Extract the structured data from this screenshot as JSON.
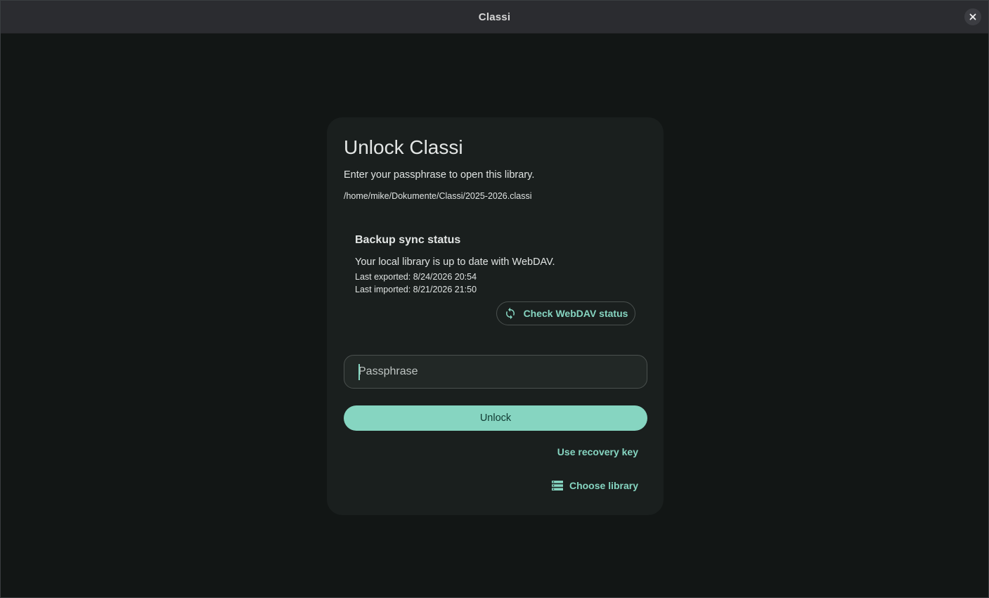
{
  "window": {
    "title": "Classi",
    "close_icon": "close-icon"
  },
  "card": {
    "title": "Unlock Classi",
    "subtitle": "Enter your passphrase to open this library.",
    "path": "/home/mike/Dokumente/Classi/2025-2026.classi"
  },
  "sync": {
    "title": "Backup sync status",
    "status": "Your local library is up to date with WebDAV.",
    "last_exported": "Last exported: 8/24/2026 20:54",
    "last_imported": "Last imported: 8/21/2026 21:50",
    "check_button": {
      "label": "Check WebDAV status",
      "icon": "sync-icon"
    }
  },
  "passphrase": {
    "value": "",
    "placeholder": "Passphrase"
  },
  "actions": {
    "unlock_label": "Unlock",
    "recovery_label": "Use recovery key",
    "choose_label": "Choose library",
    "choose_icon": "storage-icon"
  },
  "colors": {
    "background": "#121615",
    "titlebar": "#2b2c30",
    "card": "#1a1f1e",
    "accent": "#86d5c1",
    "accent_text": "#103a32",
    "text": "#dfe3e2"
  }
}
